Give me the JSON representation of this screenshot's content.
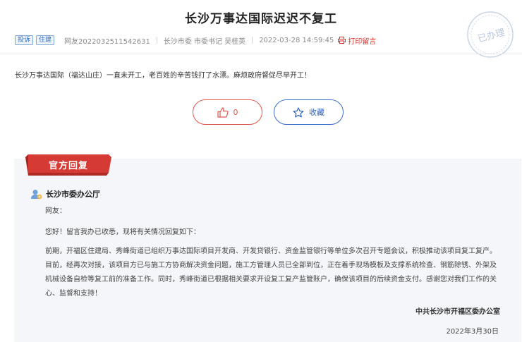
{
  "page_title": "长沙万事达国际迟迟不复工",
  "meta": {
    "tags": [
      "投诉",
      "住建"
    ],
    "user": "网友2022032511542631",
    "recipient": "长沙市委 市委书记 吴桂英",
    "timestamp": "2022-03-28 14:59:45",
    "print_label": "打印留言"
  },
  "stamp": {
    "text": "已办理"
  },
  "message": "长沙万事达国际（福达山庄）一直未开工，老百姓的辛苦钱打了水漂。麻烦政府督促尽早开工！",
  "actions": {
    "like_count": "0",
    "favorite_label": "收藏"
  },
  "reply": {
    "ribbon_label": "官方回复",
    "department": "长沙市委办公厅",
    "greeting": "网友：",
    "intro": "您好！留言我办已收悉，现将有关情况回复如下：",
    "body": "前期，开福区住建局、秀峰街道已组织万事达国际项目开发商、开发贷银行、资金监管银行等单位多次召开专题会议，积极推动该项目复工复产。目前，经再次对接，该项目方已与施工方协商解决资金问题，施工方管理人员已全部到位，正在着手现场模板及支撑系统检查、钢筋除锈、外架及机械设备自检等复工前的准备工作。同时，秀峰街道已根据相关要求开设复工复产监管账户，确保该项目的后续资金支付。感谢您对我们工作的关心、监督和支持！",
    "signature": "中共长沙市开福区委办公室",
    "date": "2022年3月30日"
  },
  "colors": {
    "accent_red": "#d7312e",
    "accent_blue": "#2d5eb8",
    "reply_bg": "#f4f6f9"
  }
}
